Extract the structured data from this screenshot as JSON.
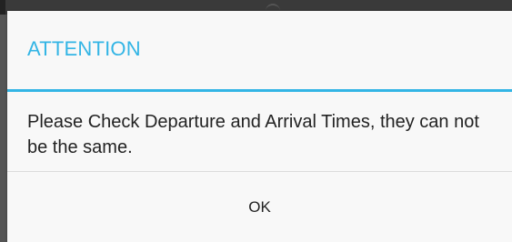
{
  "dialog": {
    "title": "ATTENTION",
    "message": "Please Check Departure and Arrival Times, they can not be the same.",
    "ok_label": "OK"
  },
  "colors": {
    "accent": "#33b5e5",
    "dialog_background": "#f8f8f8",
    "text": "#222222"
  }
}
